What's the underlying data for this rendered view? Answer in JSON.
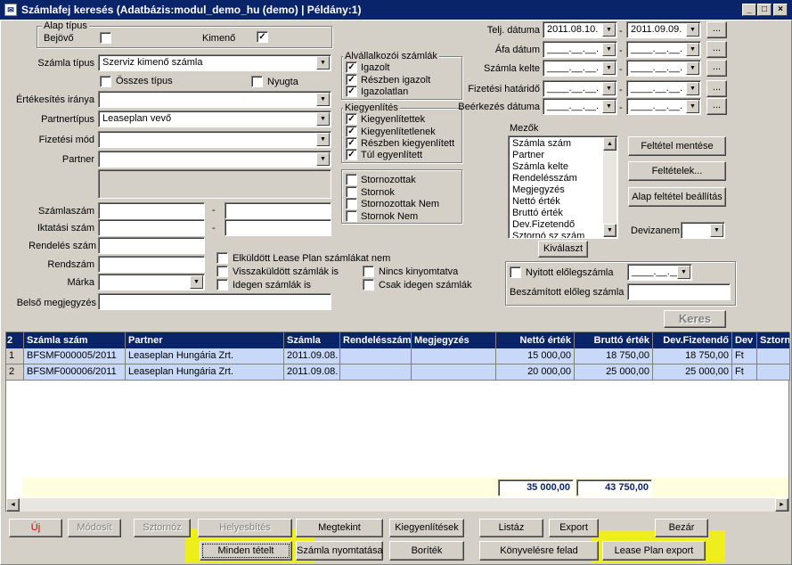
{
  "window": {
    "title": "Számlafej keresés  (Adatbázis:modul_demo_hu (demo) | Példány:1)",
    "min": "_",
    "max": "□",
    "close": "×"
  },
  "alap_tipus": {
    "title": "Alap típus",
    "bejovo": "Bejövő",
    "kimeno": "Kimenő",
    "bejovo_checked": false,
    "kimeno_checked": true
  },
  "left": {
    "szamla_tipus_label": "Számla típus",
    "szamla_tipus_value": "Szerviz kimenő számla",
    "osszes_tipus": "Összes típus",
    "nyugta": "Nyugta",
    "ertekesites_label": "Értékesítés iránya",
    "partnertipus_label": "Partnertípus",
    "partnertipus_value": "Leaseplan vevő",
    "fizetesi_mod_label": "Fizetési mód",
    "partner_label": "Partner",
    "szamlaszam_label": "Számlaszám",
    "iktatasi_label": "Iktatási szám",
    "rendeles_label": "Rendelés szám",
    "rendszam_label": "Rendszám",
    "marka_label": "Márka",
    "belso_label": "Belső megjegyzés",
    "dash": "-"
  },
  "alvall": {
    "title": "Alvállalkozói számlák",
    "items": [
      "Igazolt",
      "Részben igazolt",
      "Igazolatlan"
    ]
  },
  "kiegy": {
    "title": "Kiegyenlítés",
    "items": [
      "Kiegyenlítettek",
      "Kiegyenlítetlenek",
      "Részben kiegyenlített",
      "Túl egyenlített"
    ]
  },
  "storno": {
    "items": [
      "Stornozottak",
      "Stornok",
      "Stornozottak Nem",
      "Stornok Nem"
    ]
  },
  "extra_checks": {
    "elkuldott": "Elküldött Lease Plan számlákat nem",
    "visszakuldott": "Visszaküldött számlák is",
    "idegen": "Idegen számlák is",
    "nincs_kinyomtatva": "Nincs kinyomtatva",
    "csak_idegen": "Csak idegen számlák"
  },
  "dates": {
    "telj_label": "Telj. dátuma",
    "telj_from": "2011.08.10.",
    "telj_to": "2011.09.09.",
    "afa_label": "Áfa dátum",
    "kelte_label": "Számla kelte",
    "hatarido_label": "Fizetési határidő",
    "beerkezes_label": "Beérkezés dátuma",
    "empty": "____.__.__.",
    "dash": "-",
    "dots": "..."
  },
  "mezok": {
    "title": "Mezők",
    "items": [
      "Számla szám",
      "Partner",
      "Számla kelte",
      "Rendelésszám",
      "Megjegyzés",
      "Nettó érték",
      "Bruttó érték",
      "Dev.Fizetendő",
      "Sztornó sz.szám"
    ],
    "kivalaszt": "Kiválaszt"
  },
  "right_buttons": {
    "feltetel_mentese": "Feltétel mentése",
    "feltetelek": "Feltételek...",
    "alap_feltetel": "Alap feltétel beállítás",
    "devizanem": "Devizanem"
  },
  "eloleg": {
    "nyitott": "Nyitott előlegszámla",
    "beszamitott": "Beszámított előleg számla",
    "empty": "____.__.__."
  },
  "keres": "Keres",
  "grid": {
    "corner": "2",
    "headers": [
      "Számla szám",
      "Partner",
      "Számla",
      "Rendelésszám",
      "Megjegyzés",
      "Nettó érték",
      "Bruttó érték",
      "Dev.Fizetendő",
      "Dev",
      "Sztorn"
    ],
    "rows": [
      {
        "n": "1",
        "szam": "BFSMF000005/2011",
        "partner": "Leaseplan Hungária Zrt.",
        "datum": "2011.09.08.",
        "rend": "",
        "megj": "",
        "netto": "15 000,00",
        "brutto": "18 750,00",
        "dev_fiz": "18 750,00",
        "dev": "Ft"
      },
      {
        "n": "2",
        "szam": "BFSMF000006/2011",
        "partner": "Leaseplan Hungária Zrt.",
        "datum": "2011.09.08.",
        "rend": "",
        "megj": "",
        "netto": "20 000,00",
        "brutto": "25 000,00",
        "dev_fiz": "25 000,00",
        "dev": "Ft"
      }
    ],
    "sum_netto": "35 000,00",
    "sum_brutto": "43 750,00"
  },
  "bottom": {
    "uj": "Új",
    "modosit": "Módosít",
    "sztornoz": "Sztornóz",
    "helyesbites": "Helyesbítés",
    "megtekint": "Megtekint",
    "kiegyenlitesek": "Kiegyenlítések",
    "listaz": "Listáz",
    "export": "Export",
    "bezar": "Bezár",
    "minden_tetelt": "Minden tételt",
    "szamla_nyomtatasa": "Számla nyomtatása",
    "boritek": "Boríték",
    "konyvelesre": "Könyvelésre felad",
    "leaseplan_export": "Lease Plan export"
  }
}
